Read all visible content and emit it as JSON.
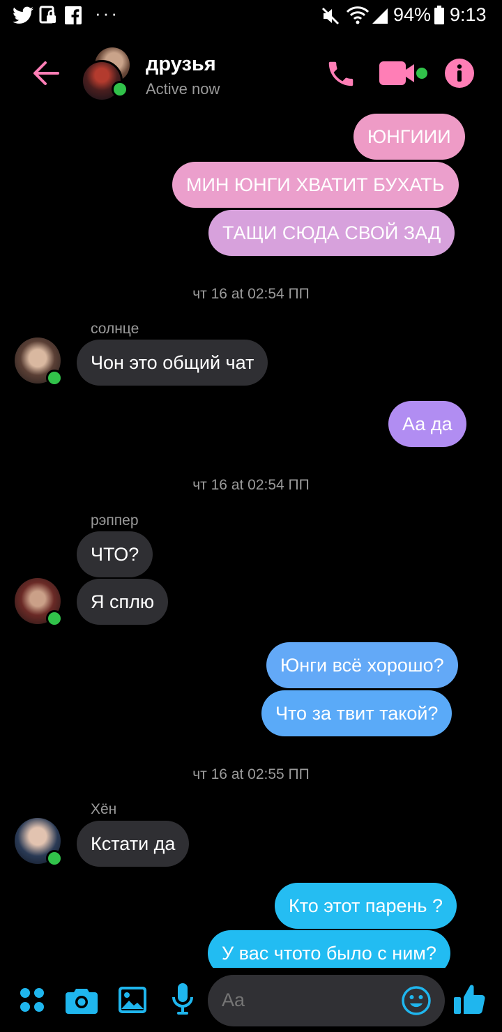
{
  "status_bar": {
    "icons_left": [
      "twitter-icon",
      "screen-lock-icon",
      "facebook-icon",
      "more-notifications-icon"
    ],
    "icons_right": [
      "mute-icon",
      "wifi-icon",
      "signal-icon",
      "battery-icon"
    ],
    "battery": "94%",
    "time": "9:13"
  },
  "header": {
    "title": "друзья",
    "subtitle": "Active now",
    "accent_color": "#ff7eb6",
    "icons": [
      "back-arrow-icon",
      "phone-icon",
      "video-camera-icon",
      "info-icon"
    ]
  },
  "messages": [
    {
      "type": "sent",
      "text": "ЮНГИИИ",
      "color": "#ee9bc6"
    },
    {
      "type": "sent",
      "text": "МИН ЮНГИ ХВАТИТ БУХАТЬ",
      "color": "#e99dc9"
    },
    {
      "type": "sent",
      "text": "ТАЩИ СЮДА СВОЙ ЗАД",
      "color": "#d99fd9"
    },
    {
      "type": "timestamp",
      "text": "чт 16 at 02:54 ПП"
    },
    {
      "type": "sender",
      "text": "солнце"
    },
    {
      "type": "received",
      "text": "Чон это общий чат"
    },
    {
      "type": "sent",
      "text": "Аа да",
      "color": "#b18df2"
    },
    {
      "type": "timestamp",
      "text": "чт 16 at 02:54 ПП"
    },
    {
      "type": "sender",
      "text": "рэппер"
    },
    {
      "type": "received",
      "text": "ЧТО?"
    },
    {
      "type": "received",
      "text": "Я сплю"
    },
    {
      "type": "sent",
      "text": "Юнги всё хорошо?",
      "color": "#63a9f7"
    },
    {
      "type": "sent",
      "text": "Что за твит такой?",
      "color": "#5aaaf8"
    },
    {
      "type": "timestamp",
      "text": "чт 16 at 02:55 ПП"
    },
    {
      "type": "sender",
      "text": "Хён"
    },
    {
      "type": "received",
      "text": "Кстати да"
    },
    {
      "type": "sent",
      "text": "Кто этот парень ?",
      "color": "#25bdf2"
    },
    {
      "type": "sent",
      "text": "У вас чтото было с ним?",
      "color": "#22bcf2"
    }
  ],
  "composer": {
    "placeholder": "Aa",
    "icon_color": "#1fb6ee",
    "icons": [
      "menu-dots-icon",
      "camera-icon",
      "gallery-icon",
      "microphone-icon",
      "emoji-icon",
      "thumbs-up-icon"
    ]
  }
}
